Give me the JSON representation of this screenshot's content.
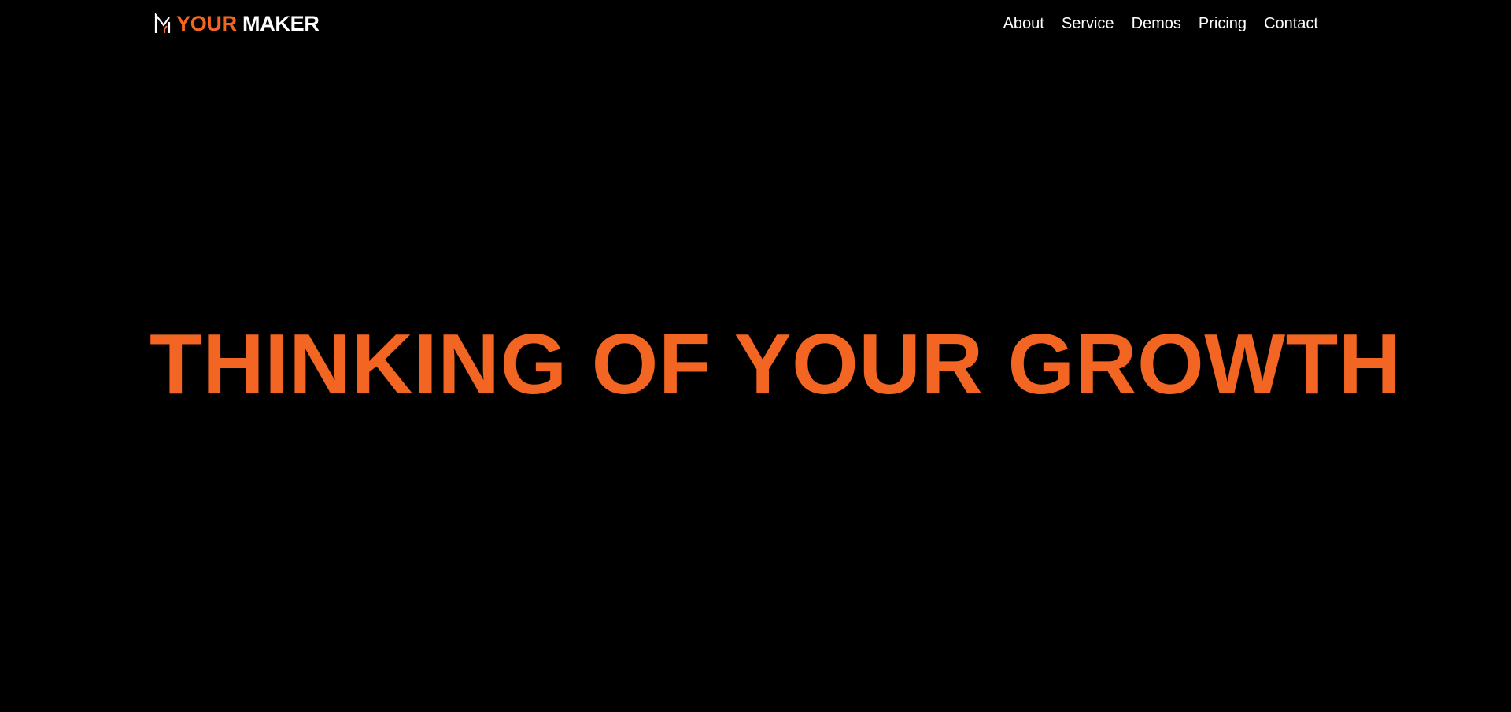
{
  "brand": {
    "accent_word": "YOUR",
    "main_word": "MAKER",
    "logo_icon": "m-monogram-icon",
    "accent_color": "#f26522",
    "text_color": "#ffffff",
    "background_color": "#000000"
  },
  "nav": {
    "items": [
      {
        "label": "About"
      },
      {
        "label": "Service"
      },
      {
        "label": "Demos"
      },
      {
        "label": "Pricing"
      },
      {
        "label": "Contact"
      }
    ]
  },
  "hero": {
    "title": "THINKING OF YOUR GROWTH"
  }
}
